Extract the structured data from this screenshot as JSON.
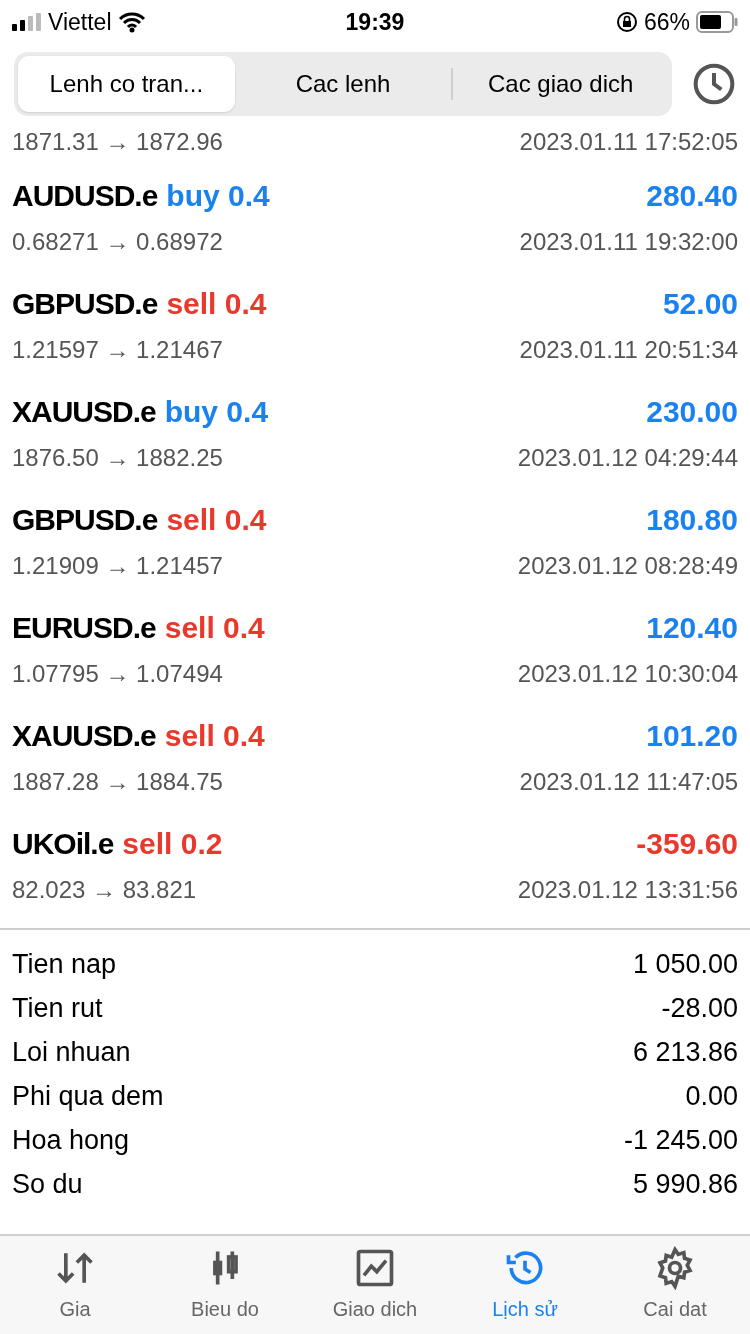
{
  "status_bar": {
    "carrier": "Viettel",
    "time": "19:39",
    "battery": "66%"
  },
  "segments": [
    {
      "label": "Lenh co tran...",
      "selected": true
    },
    {
      "label": "Cac lenh",
      "selected": false
    },
    {
      "label": "Cac giao dich",
      "selected": false
    }
  ],
  "partial_trade": {
    "prices": "1871.31 → 1872.96",
    "time": "2023.01.11 17:52:05"
  },
  "trades": [
    {
      "symbol": "AUDUSD.e",
      "order": "buy 0.4",
      "sell": false,
      "profit": "280.40",
      "loss": false,
      "prices": "0.68271 → 0.68972",
      "time": "2023.01.11 19:32:00"
    },
    {
      "symbol": "GBPUSD.e",
      "order": "sell 0.4",
      "sell": true,
      "profit": "52.00",
      "loss": false,
      "prices": "1.21597 → 1.21467",
      "time": "2023.01.11 20:51:34"
    },
    {
      "symbol": "XAUUSD.e",
      "order": "buy 0.4",
      "sell": false,
      "profit": "230.00",
      "loss": false,
      "prices": "1876.50 → 1882.25",
      "time": "2023.01.12 04:29:44"
    },
    {
      "symbol": "GBPUSD.e",
      "order": "sell 0.4",
      "sell": true,
      "profit": "180.80",
      "loss": false,
      "prices": "1.21909 → 1.21457",
      "time": "2023.01.12 08:28:49"
    },
    {
      "symbol": "EURUSD.e",
      "order": "sell 0.4",
      "sell": true,
      "profit": "120.40",
      "loss": false,
      "prices": "1.07795 → 1.07494",
      "time": "2023.01.12 10:30:04"
    },
    {
      "symbol": "XAUUSD.e",
      "order": "sell 0.4",
      "sell": true,
      "profit": "101.20",
      "loss": false,
      "prices": "1887.28 → 1884.75",
      "time": "2023.01.12 11:47:05"
    },
    {
      "symbol": "UKOil.e",
      "order": "sell 0.2",
      "sell": true,
      "profit": "-359.60",
      "loss": true,
      "prices": "82.023 → 83.821",
      "time": "2023.01.12 13:31:56"
    }
  ],
  "summary": [
    {
      "label": "Tien nap",
      "value": "1 050.00"
    },
    {
      "label": "Tien rut",
      "value": "-28.00"
    },
    {
      "label": "Loi nhuan",
      "value": "6 213.86"
    },
    {
      "label": "Phi qua dem",
      "value": "0.00"
    },
    {
      "label": "Hoa hong",
      "value": "-1 245.00"
    },
    {
      "label": "So du",
      "value": "5 990.86"
    }
  ],
  "tab_bar": [
    {
      "label": "Gia",
      "selected": false
    },
    {
      "label": "Bieu do",
      "selected": false
    },
    {
      "label": "Giao dich",
      "selected": false
    },
    {
      "label": "Lịch sử",
      "selected": true
    },
    {
      "label": "Cai dat",
      "selected": false
    }
  ]
}
